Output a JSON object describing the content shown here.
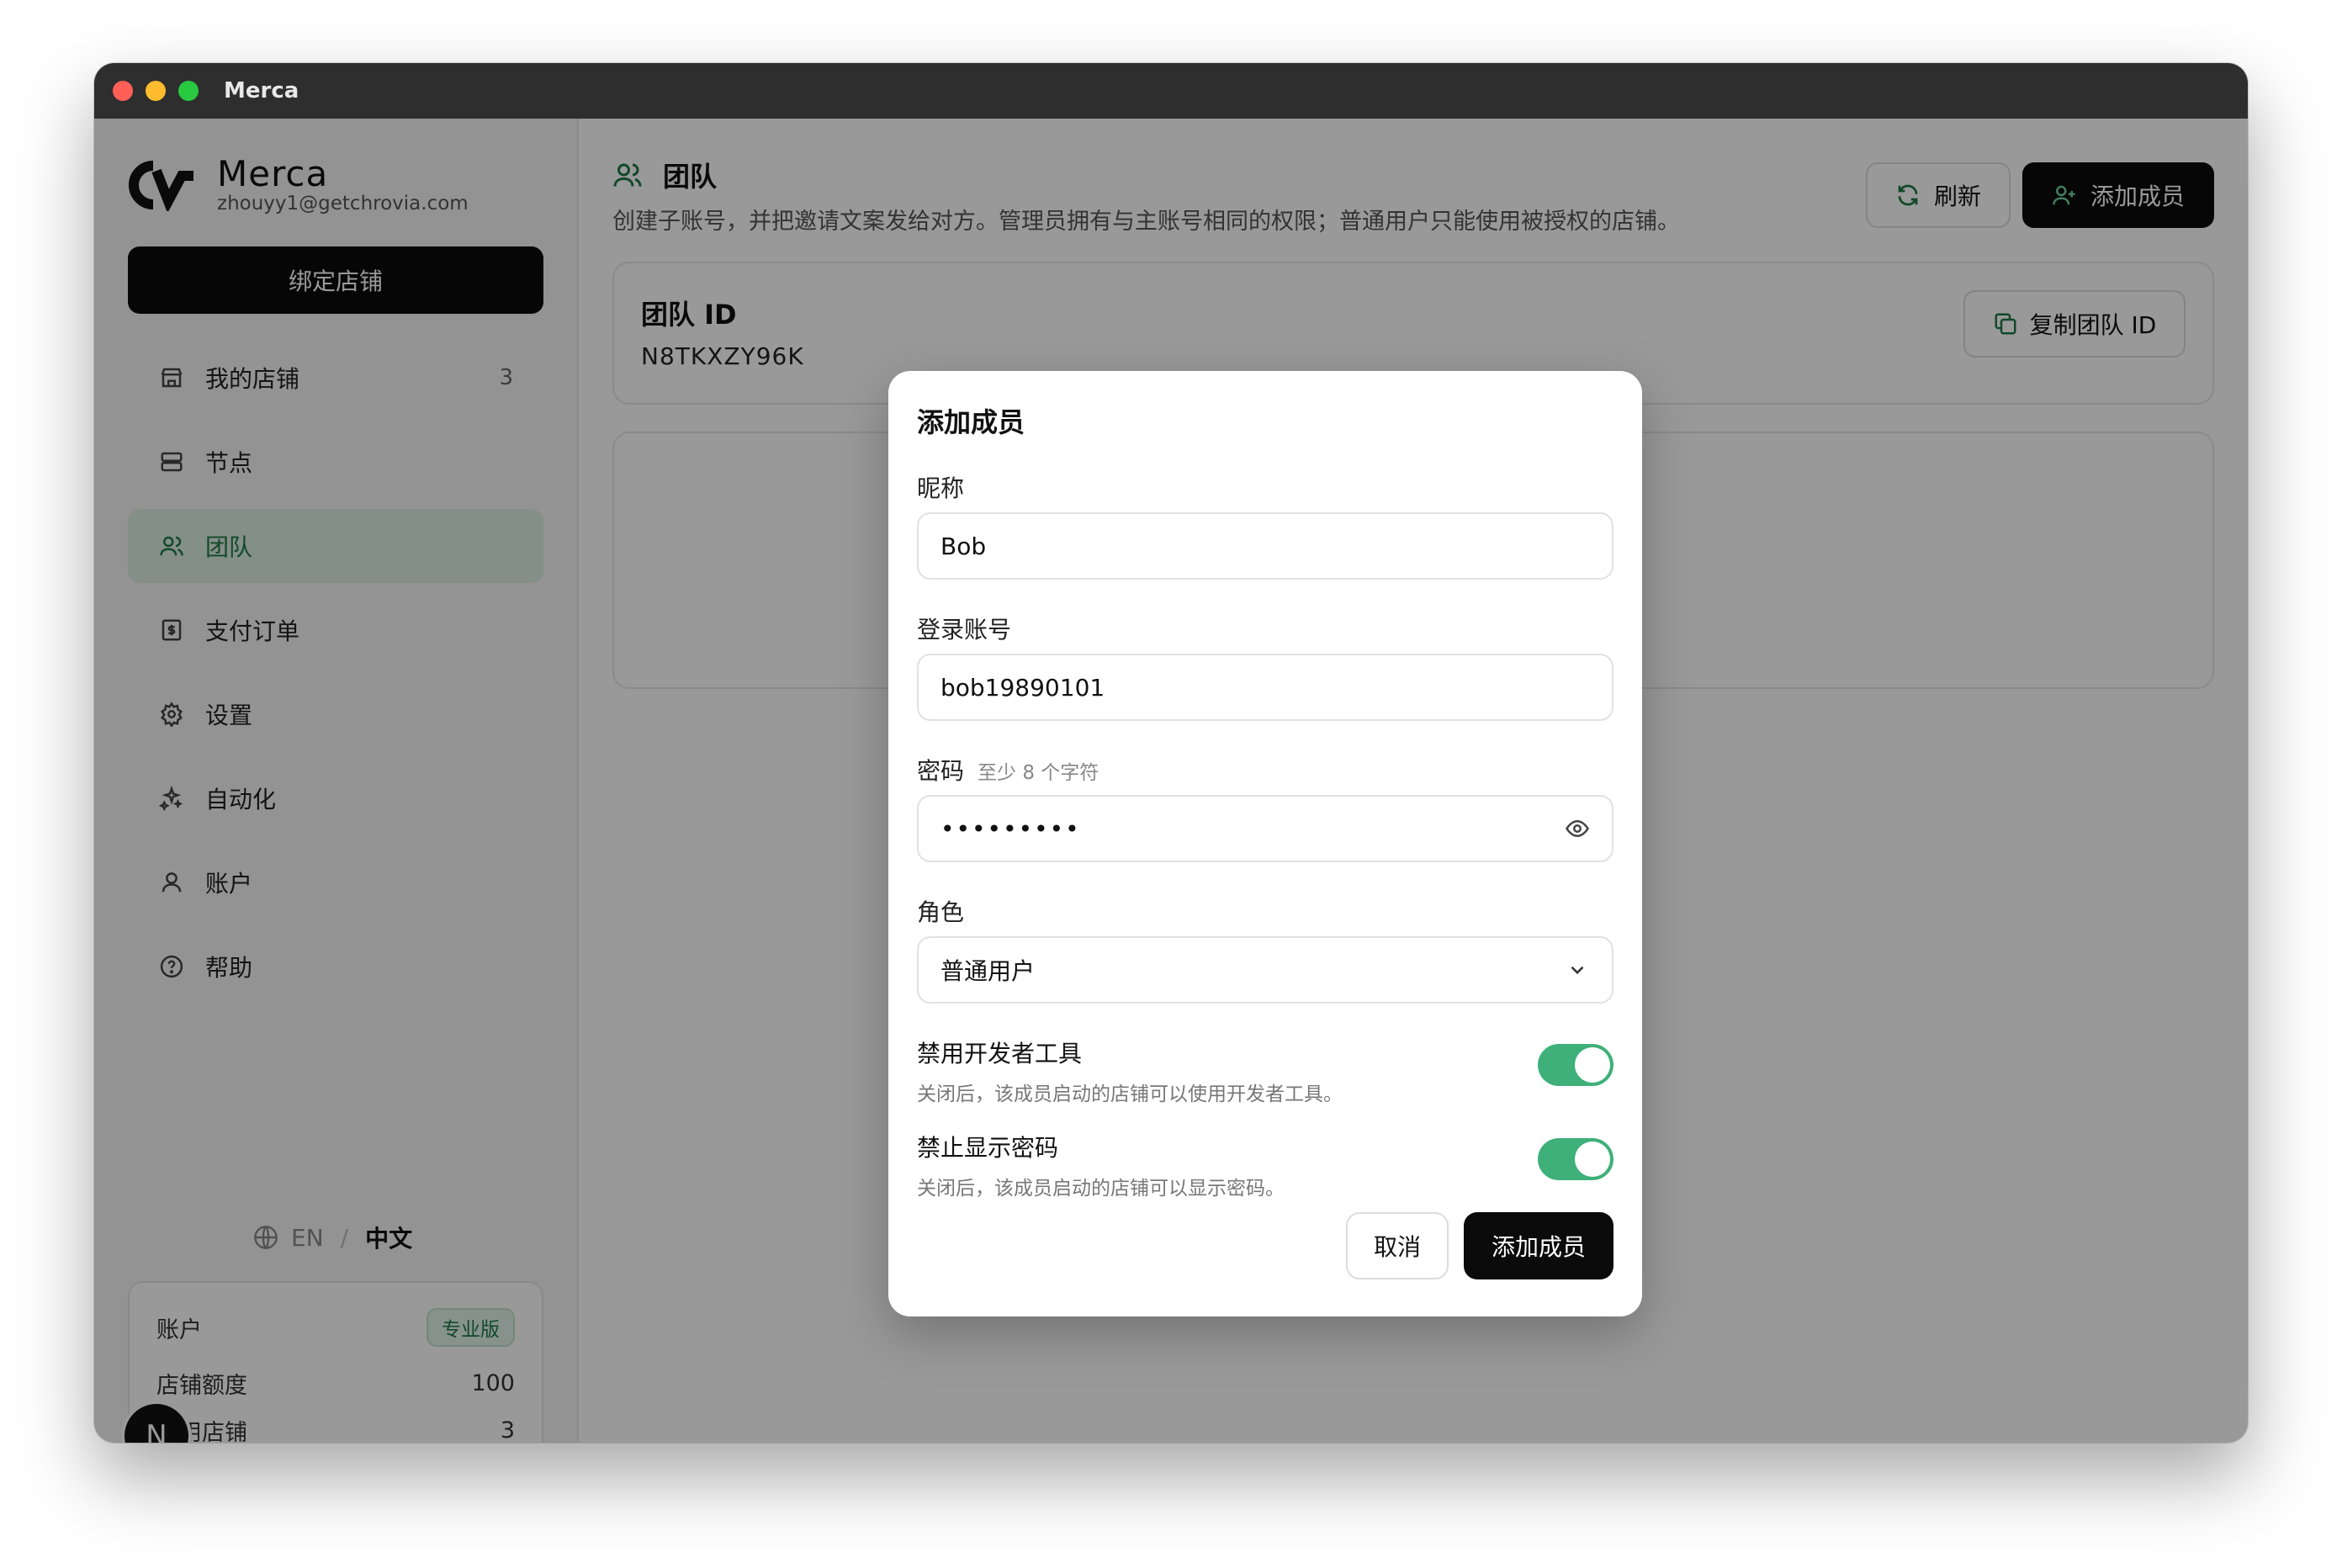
{
  "window": {
    "title": "Merca"
  },
  "sidebar": {
    "brand_name": "Merca",
    "user_email": "zhouyy1@getchrovia.com",
    "bind_store_label": "绑定店铺",
    "items": [
      {
        "label": "我的店铺",
        "icon": "store-icon",
        "count": "3"
      },
      {
        "label": "节点",
        "icon": "server-icon"
      },
      {
        "label": "团队",
        "icon": "users-icon",
        "active": true
      },
      {
        "label": "支付订单",
        "icon": "receipt-icon"
      },
      {
        "label": "设置",
        "icon": "gear-icon"
      },
      {
        "label": "自动化",
        "icon": "automation-icon"
      },
      {
        "label": "账户",
        "icon": "user-icon"
      },
      {
        "label": "帮助",
        "icon": "help-icon"
      }
    ],
    "lang": {
      "en": "EN",
      "sep": "/",
      "zh": "中文"
    },
    "account": {
      "title": "账户",
      "plan": "专业版",
      "quota_label": "店铺额度",
      "quota_value": "100",
      "used_label": "已用店铺",
      "used_value": "3"
    },
    "avatar_letter": "N"
  },
  "main": {
    "title": "团队",
    "description": "创建子账号，并把邀请文案发给对方。管理员拥有与主账号相同的权限；普通用户只能使用被授权的店铺。",
    "refresh_label": "刷新",
    "add_member_label": "添加成员",
    "team_id_label": "团队 ID",
    "team_id_value": "N8TKXZY96K",
    "copy_team_id_label": "复制团队 ID"
  },
  "dialog": {
    "title": "添加成员",
    "nickname_label": "昵称",
    "nickname_value": "Bob",
    "login_label": "登录账号",
    "login_value": "bob19890101",
    "password_label": "密码",
    "password_hint": "至少 8 个字符",
    "password_masked": "•••••••••",
    "role_label": "角色",
    "role_value": "普通用户",
    "toggle1_title": "禁用开发者工具",
    "toggle1_desc": "关闭后，该成员启动的店铺可以使用开发者工具。",
    "toggle1_on": true,
    "toggle2_title": "禁止显示密码",
    "toggle2_desc": "关闭后，该成员启动的店铺可以显示密码。",
    "toggle2_on": true,
    "cancel_label": "取消",
    "submit_label": "添加成员"
  },
  "colors": {
    "accent": "#3fb07a",
    "primary": "#0b0b0b",
    "active_bg": "#dcefe3"
  }
}
